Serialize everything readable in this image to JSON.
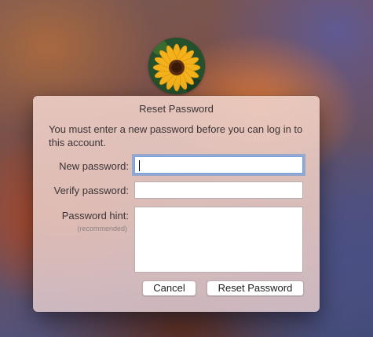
{
  "dialog": {
    "title": "Reset Password",
    "message": "You must enter a new password before you can log in to this account.",
    "fields": {
      "new_password": {
        "label": "New password:",
        "value": ""
      },
      "verify_password": {
        "label": "Verify password:",
        "value": ""
      },
      "password_hint": {
        "label": "Password hint:",
        "sublabel": "(recommended)",
        "value": ""
      }
    },
    "buttons": {
      "cancel": "Cancel",
      "reset": "Reset Password"
    }
  },
  "avatar": {
    "icon": "sunflower-avatar-icon"
  },
  "colors": {
    "focus_ring": "#5c94de"
  }
}
